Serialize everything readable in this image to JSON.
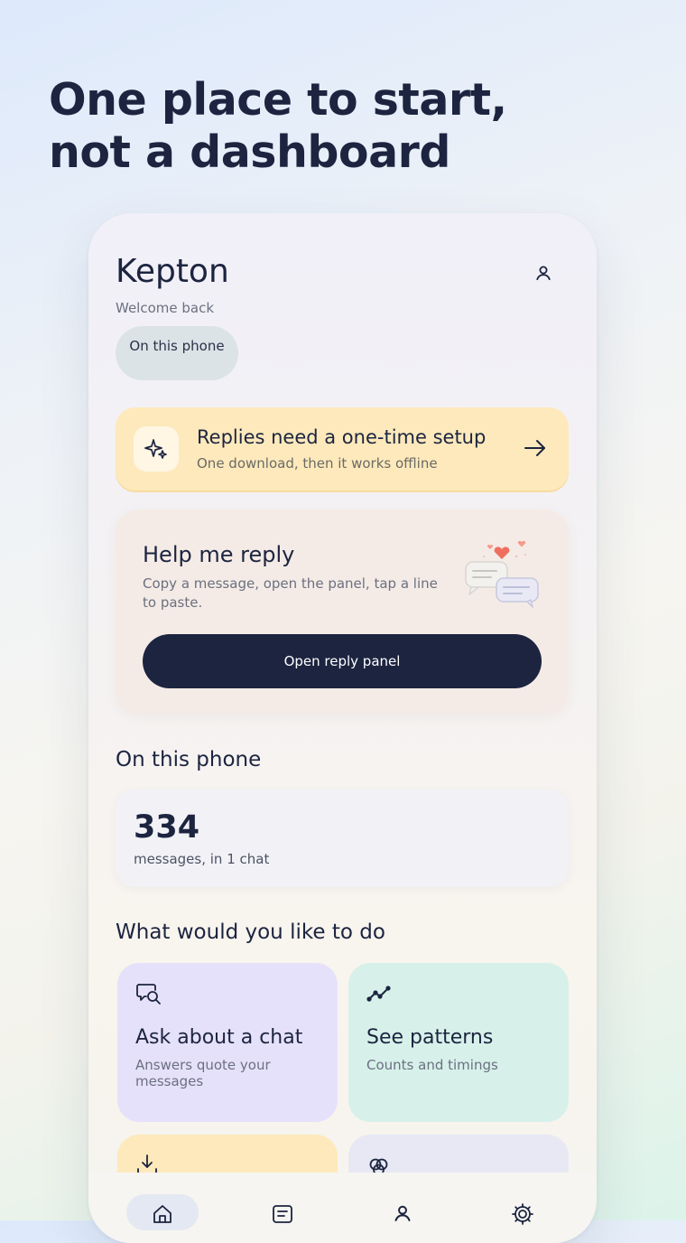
{
  "headline": "One place to start,\nnot a dashboard",
  "app": {
    "title": "Kepton",
    "welcome": "Welcome back",
    "chip_label": "On this phone"
  },
  "setup_card": {
    "title": "Replies need a one-time setup",
    "subtitle": "One download, then it works offline",
    "icon": "sparkle-icon",
    "action_icon": "arrow-right-icon"
  },
  "reply_card": {
    "title": "Help me reply",
    "description": "Copy a message, open the panel, tap a line to paste.",
    "button_label": "Open reply panel",
    "illustration": "chat-hearts-illustration"
  },
  "stats_section": {
    "title": "On this phone",
    "count": "334",
    "label": "messages, in 1 chat"
  },
  "actions_section": {
    "title": "What would you like to do",
    "tiles": [
      {
        "title": "Ask about a chat",
        "subtitle": "Answers quote your messages",
        "icon": "chat-search-icon",
        "color": "#e6e1fb"
      },
      {
        "title": "See patterns",
        "subtitle": "Counts and timings",
        "icon": "trend-line-icon",
        "color": "#d7f1ea"
      },
      {
        "title": "",
        "subtitle": "",
        "icon": "download-icon",
        "color": "#fde9bb"
      },
      {
        "title": "",
        "subtitle": "",
        "icon": "circles-icon",
        "color": "#e7e8f4"
      }
    ]
  },
  "bottom_nav": {
    "items": [
      {
        "icon": "home-icon",
        "active": true
      },
      {
        "icon": "list-icon",
        "active": false
      },
      {
        "icon": "user-icon",
        "active": false
      },
      {
        "icon": "settings-icon",
        "active": false
      }
    ]
  },
  "colors": {
    "primary": "#1c2440",
    "setup_bg": "#fde9bb",
    "reply_bg": "#f4ebe6",
    "heart": "#ef6f5e"
  }
}
